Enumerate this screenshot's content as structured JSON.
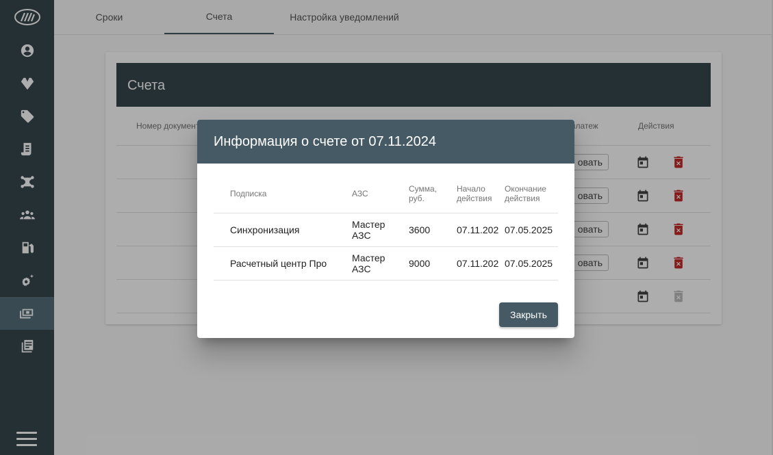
{
  "tabs": [
    "Сроки",
    "Счета",
    "Настройка уведомлений"
  ],
  "card": {
    "title": "Счета",
    "headers": {
      "doc_number": "Номер документ",
      "payment": "платеж",
      "actions": "Действия"
    },
    "pay_button_label": "овать"
  },
  "dialog": {
    "title": "Информация о счете от 07.11.2024",
    "headers": {
      "subscription": "Подписка",
      "station": "АЗС",
      "sum_line1": "Сумма,",
      "sum_line2": "руб.",
      "start_line1": "Начало",
      "start_line2": "действия",
      "end_line1": "Окончание",
      "end_line2": "действия"
    },
    "rows": [
      {
        "subscription": "Синхронизация",
        "station_line1": "Мастер",
        "station_line2": "АЗС",
        "sum": "3600",
        "start": "07.11.202",
        "end": "07.05.2025"
      },
      {
        "subscription": "Расчетный центр Про",
        "station_line1": "Мастер",
        "station_line2": "АЗС",
        "sum": "9000",
        "start": "07.11.202",
        "end": "07.05.2025"
      }
    ],
    "close_label": "Закрыть"
  },
  "colors": {
    "sidebar": "#37474f",
    "dialog_header": "#455a64",
    "delete_icon": "#c62828"
  }
}
